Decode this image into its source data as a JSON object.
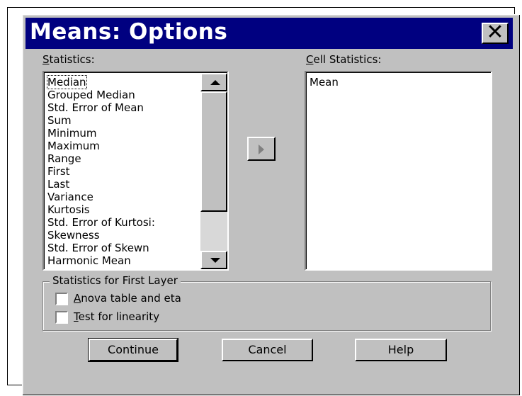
{
  "dialog": {
    "title": "Means: Options",
    "close_label": "✕"
  },
  "statistics": {
    "label": "Statistics:",
    "items": [
      "Median",
      "Grouped Median",
      "Std. Error of Mean",
      "Sum",
      "Minimum",
      "Maximum",
      "Range",
      "First",
      "Last",
      "Variance",
      "Kurtosis",
      "Std. Error of Kurtosi:",
      "Skewness",
      "Std. Error of Skewn",
      "Harmonic Mean"
    ]
  },
  "cell_statistics": {
    "label": "Cell Statistics:",
    "items": [
      "Mean"
    ]
  },
  "first_layer": {
    "label": "Statistics for First Layer",
    "anova": "Anova table and eta",
    "linearity": "Test for linearity"
  },
  "buttons": {
    "continue": "Continue",
    "cancel": "Cancel",
    "help": "Help"
  }
}
